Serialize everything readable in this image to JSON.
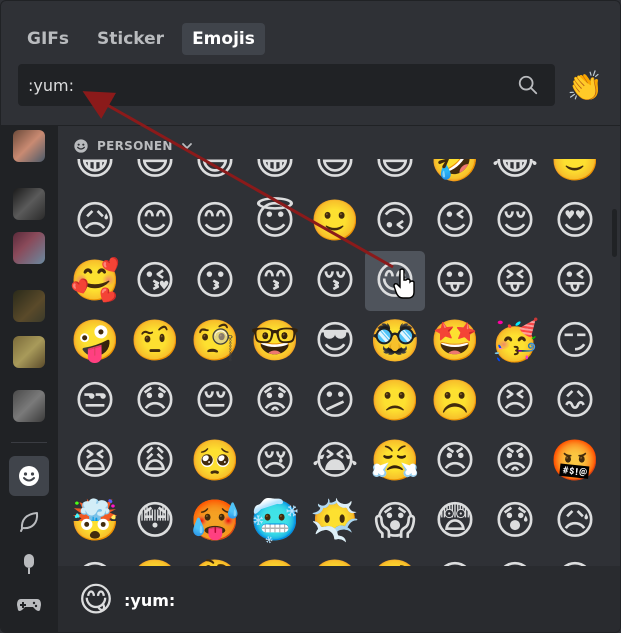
{
  "tabs": [
    {
      "label": "GIFs",
      "active": false
    },
    {
      "label": "Sticker",
      "active": false
    },
    {
      "label": "Emojis",
      "active": true
    }
  ],
  "search": {
    "value": ":yum:",
    "icon": "search-icon"
  },
  "skin_tone_button": {
    "emoji": "👏"
  },
  "category": {
    "label": "PERSONEN",
    "icon": "smiley-icon",
    "chevron": "chevron-down-icon"
  },
  "emoji_grid": [
    [
      "😀",
      "😃",
      "😄",
      "😁",
      "😆",
      "😅",
      "🤣",
      "😂",
      "🙂"
    ],
    [
      "😥",
      "😊",
      "😊",
      "😇",
      "🙂",
      "🙃",
      "😉",
      "😌",
      "😍"
    ],
    [
      "🥰",
      "😘",
      "😗",
      "😙",
      "😚",
      "😋",
      "😛",
      "😝",
      "😜"
    ],
    [
      "🤪",
      "🤨",
      "🧐",
      "🤓",
      "😎",
      "🥸",
      "🤩",
      "🥳",
      "😏"
    ],
    [
      "😒",
      "😞",
      "😔",
      "😟",
      "😕",
      "🙁",
      "☹️",
      "😣",
      "😖"
    ],
    [
      "😫",
      "😩",
      "🥺",
      "😢",
      "😭",
      "😤",
      "😠",
      "😡",
      "🤬"
    ],
    [
      "🤯",
      "😳",
      "🥵",
      "🥶",
      "😶‍🌫️",
      "😱",
      "😨",
      "😰",
      "😥"
    ],
    [
      "😓",
      "🤗",
      "🤔",
      "🤭",
      "🤫",
      "🤥",
      "😶",
      "😐",
      "😑"
    ]
  ],
  "hovered": {
    "row": 2,
    "col": 5
  },
  "footer": {
    "emoji": "😋",
    "name": ":yum:"
  },
  "sidebar_categories": [
    "smiley-icon",
    "leaf-icon",
    "popsicle-icon",
    "gamepad-icon"
  ],
  "colors": {
    "background": "#2f3136",
    "sidebar": "#202225",
    "active_tab": "#40444b",
    "arrow": "#8b1a1a"
  }
}
